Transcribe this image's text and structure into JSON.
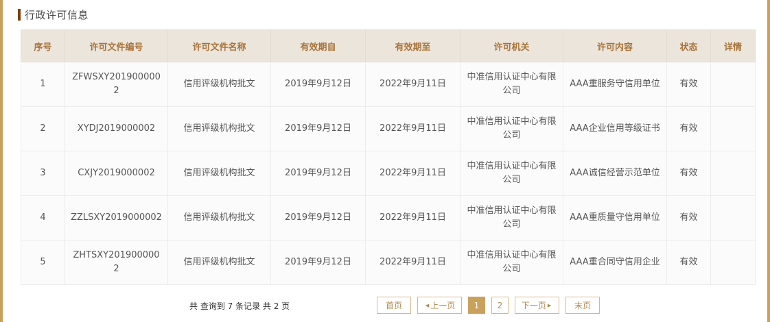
{
  "section": {
    "title": "行政许可信息"
  },
  "table": {
    "columns": [
      "序号",
      "许可文件编号",
      "许可文件名称",
      "有效期自",
      "有效期至",
      "许可机关",
      "许可内容",
      "状态",
      "详情"
    ],
    "rows": [
      [
        "1",
        "ZFWSXY2019000002",
        "信用评级机构批文",
        "2019年9月12日",
        "2022年9月11日",
        "中准信用认证中心有限公司",
        "AAA重服务守信用单位",
        "有效",
        ""
      ],
      [
        "2",
        "XYDJ2019000002",
        "信用评级机构批文",
        "2019年9月12日",
        "2022年9月11日",
        "中准信用认证中心有限公司",
        "AAA企业信用等级证书",
        "有效",
        ""
      ],
      [
        "3",
        "CXJY2019000002",
        "信用评级机构批文",
        "2019年9月12日",
        "2022年9月11日",
        "中准信用认证中心有限公司",
        "AAA诚信经营示范单位",
        "有效",
        ""
      ],
      [
        "4",
        "ZZLSXY2019000002",
        "信用评级机构批文",
        "2019年9月12日",
        "2022年9月11日",
        "中准信用认证中心有限公司",
        "AAA重质量守信用单位",
        "有效",
        ""
      ],
      [
        "5",
        "ZHTSXY2019000002",
        "信用评级机构批文",
        "2019年9月12日",
        "2022年9月11日",
        "中准信用认证中心有限公司",
        "AAA重合同守信用企业",
        "有效",
        ""
      ]
    ]
  },
  "pagination": {
    "info": "共 查询到 7 条记录 共 2 页",
    "first": "首页",
    "prev": "上一页",
    "pages": [
      "1",
      "2"
    ],
    "current": "1",
    "next": "下一页",
    "last": "末页"
  },
  "colors": {
    "accent": "#c9a15c",
    "header_bg": "#ece5dc",
    "header_text": "#a8743a",
    "title_bar": "#7a3f10"
  }
}
